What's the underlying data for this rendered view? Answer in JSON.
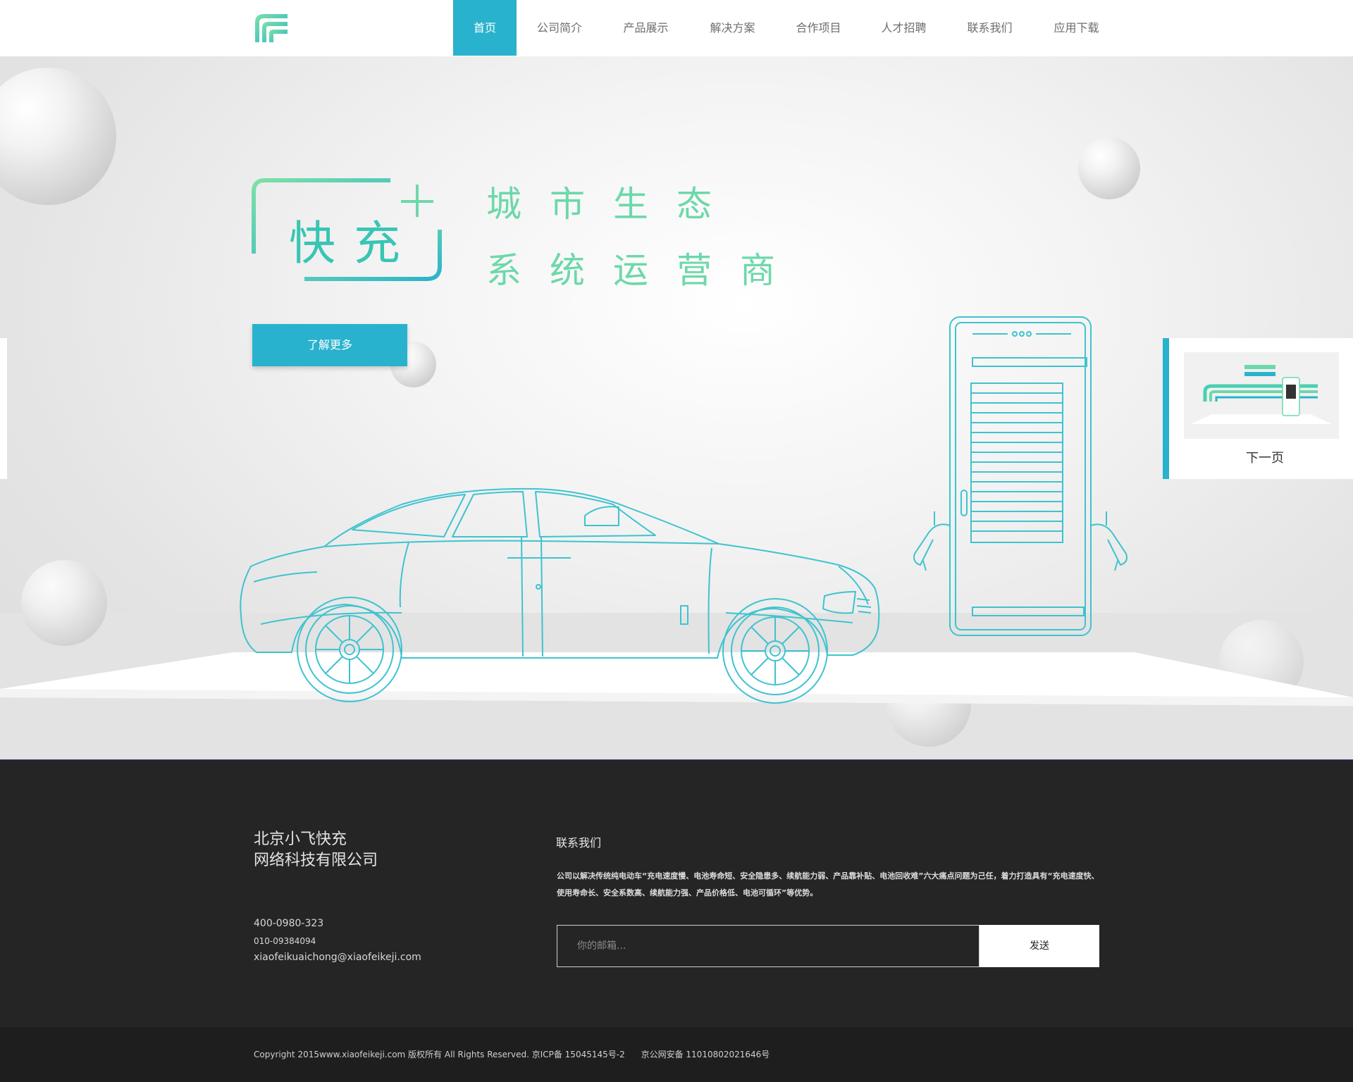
{
  "nav": {
    "items": [
      {
        "label": "首页",
        "active": true
      },
      {
        "label": "公司简介",
        "active": false
      },
      {
        "label": "产品展示",
        "active": false
      },
      {
        "label": "解决方案",
        "active": false
      },
      {
        "label": "合作项目",
        "active": false
      },
      {
        "label": "人才招聘",
        "active": false
      },
      {
        "label": "联系我们",
        "active": false
      },
      {
        "label": "应用下载",
        "active": false
      }
    ]
  },
  "hero": {
    "badge_text": "快充",
    "slogan_line1": "城市生态",
    "slogan_line2": "系统运营商",
    "learn_more_label": "了解更多",
    "next_label": "下一页",
    "colors": {
      "accent": "#29b2cd",
      "slogan": "#6dd8a9",
      "outline": "#3ec3cf"
    }
  },
  "footer": {
    "company_line1": "北京小飞快充",
    "company_line2": "网络科技有限公司",
    "phone1": "400-0980-323",
    "phone2": "010-09384094",
    "email": "xiaofeikuaichong@xiaofeikeji.com",
    "contact_title": "联系我们",
    "description": "公司以解决传统纯电动车“充电速度慢、电池寿命短、安全隐患多、续航能力弱、产品靠补贴、电池回收难”六大痛点问题为己任，着力打造具有“充电速度快、使用寿命长、安全系数高、续航能力强、产品价格低、电池可循环”等优势。",
    "email_placeholder": "你的邮箱...",
    "send_label": "发送",
    "copyright": "Copyright 2015www.xiaofeikeji.com 版权所有 All Rights Reserved. 京ICP备 15045145号-2      京公网安备 11010802021646号"
  }
}
